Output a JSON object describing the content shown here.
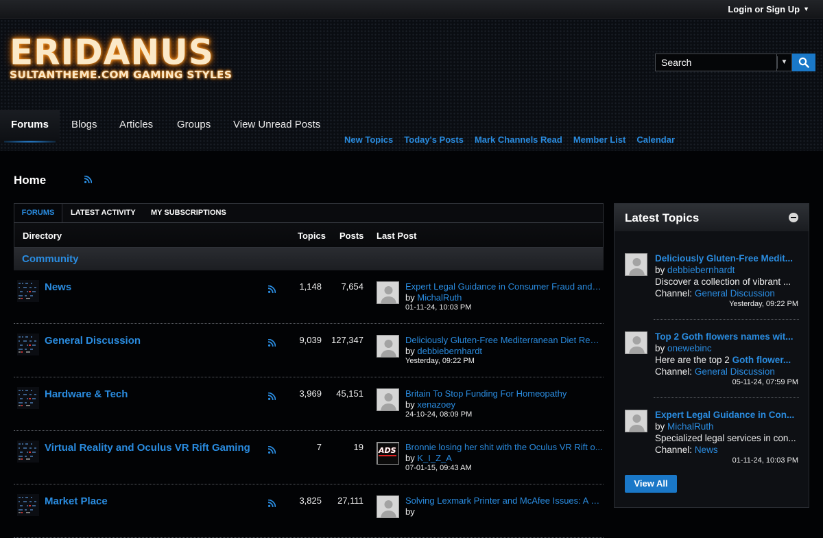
{
  "topbar": {
    "login_label": "Login or Sign Up"
  },
  "logo": {
    "title": "ERIDANUS",
    "subtitle": "SULTANTHEME.COM GAMING STYLES"
  },
  "search": {
    "placeholder": "Search"
  },
  "nav": {
    "tabs": [
      "Forums",
      "Blogs",
      "Articles",
      "Groups",
      "View Unread Posts"
    ]
  },
  "subnav": {
    "links": [
      "New Topics",
      "Today's Posts",
      "Mark Channels Read",
      "Member List",
      "Calendar"
    ]
  },
  "breadcrumb": {
    "home": "Home"
  },
  "main_tabs": [
    "FORUMS",
    "LATEST ACTIVITY",
    "MY SUBSCRIPTIONS"
  ],
  "columns": {
    "directory": "Directory",
    "topics": "Topics",
    "posts": "Posts",
    "last_post": "Last Post"
  },
  "section": {
    "title": "Community"
  },
  "forums": [
    {
      "name": "News",
      "topics": "1,148",
      "posts": "7,654",
      "lp_title": "Expert Legal Guidance in Consumer Fraud and E...",
      "lp_by": "by",
      "lp_user": "MichalRuth",
      "lp_date": "01-11-24, 10:03 PM"
    },
    {
      "name": "General Discussion",
      "topics": "9,039",
      "posts": "127,347",
      "lp_title": "Deliciously Gluten-Free Mediterranean Diet Reci...",
      "lp_by": "by",
      "lp_user": "debbiebernhardt",
      "lp_date": "Yesterday, 09:22 PM"
    },
    {
      "name": "Hardware & Tech",
      "topics": "3,969",
      "posts": "45,151",
      "lp_title": "Britain To Stop Funding For Homeopathy",
      "lp_by": "by",
      "lp_user": "xenazoey",
      "lp_date": "24-10-24, 08:09 PM"
    },
    {
      "name": "Virtual Reality and Oculus VR Rift Gaming",
      "topics": "7",
      "posts": "19",
      "lp_title": "Bronnie losing her shit with the Oculus VR Rift o...",
      "lp_by": "by",
      "lp_user": "K_I_Z_A",
      "lp_date": "07-01-15, 09:43 AM",
      "avatar_text": "ADS"
    },
    {
      "name": "Market Place",
      "topics": "3,825",
      "posts": "27,111",
      "lp_title": "Solving Lexmark Printer and McAfee Issues: A C...",
      "lp_by": "by",
      "lp_user": "",
      "lp_date": ""
    }
  ],
  "sidebar": {
    "title": "Latest Topics",
    "topics": [
      {
        "title": "Deliciously Gluten-Free Medit...",
        "by": "by",
        "user": "debbiebernhardt",
        "snippet": "Discover a collection of vibrant ...",
        "channel_label": "Channel:",
        "channel": "General Discussion",
        "date": "Yesterday, 09:22 PM"
      },
      {
        "title": "Top 2 Goth flowers names wit...",
        "by": "by",
        "user": "onewebinc",
        "snippet_pre": "Here are the top 2 ",
        "snippet_link": "Goth flower...",
        "channel_label": "Channel:",
        "channel": "General Discussion",
        "date": "05-11-24, 07:59 PM"
      },
      {
        "title": "Expert Legal Guidance in Con...",
        "by": "by",
        "user": "MichalRuth",
        "snippet": "Specialized legal services in con...",
        "channel_label": "Channel:",
        "channel": "News",
        "date": "01-11-24, 10:03 PM"
      }
    ],
    "view_all": "View All"
  },
  "colors": {
    "accent": "#2a8ce0",
    "button": "#1a78c8",
    "background": "#020305"
  }
}
